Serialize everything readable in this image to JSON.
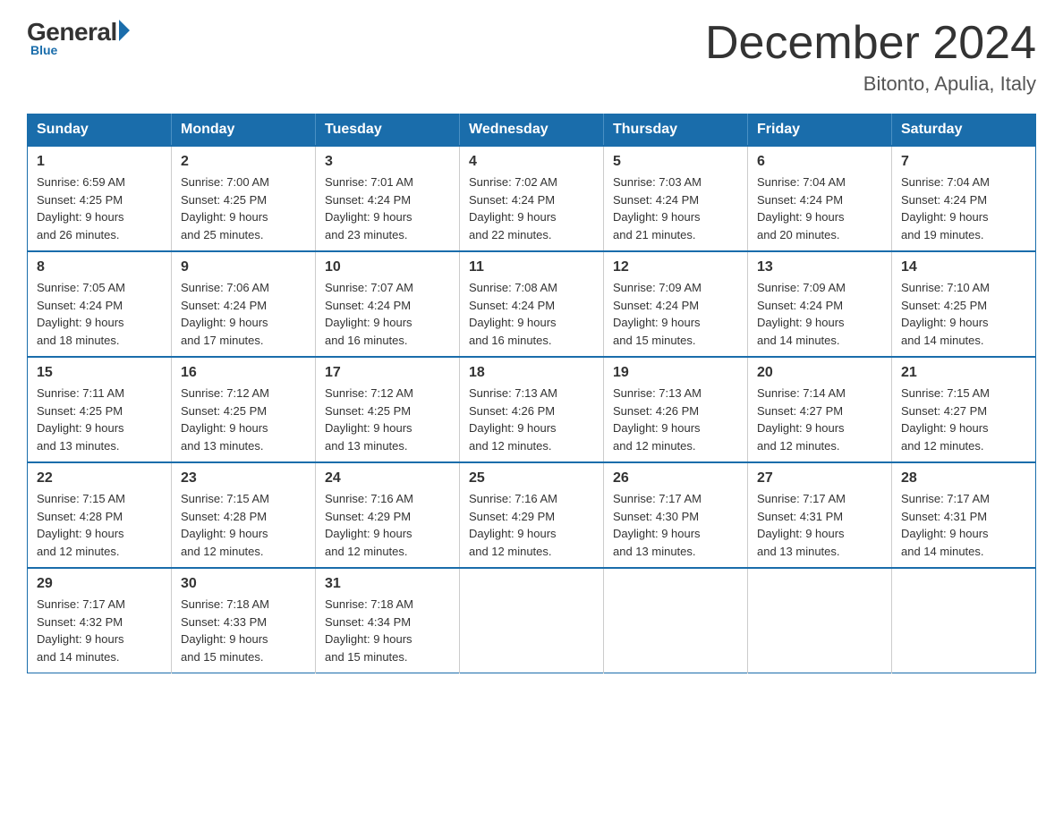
{
  "logo": {
    "general": "General",
    "blue": "Blue",
    "tagline": "Blue"
  },
  "header": {
    "month": "December 2024",
    "location": "Bitonto, Apulia, Italy"
  },
  "days_of_week": [
    "Sunday",
    "Monday",
    "Tuesday",
    "Wednesday",
    "Thursday",
    "Friday",
    "Saturday"
  ],
  "weeks": [
    [
      {
        "day": "1",
        "sunrise": "6:59 AM",
        "sunset": "4:25 PM",
        "daylight": "9 hours and 26 minutes."
      },
      {
        "day": "2",
        "sunrise": "7:00 AM",
        "sunset": "4:25 PM",
        "daylight": "9 hours and 25 minutes."
      },
      {
        "day": "3",
        "sunrise": "7:01 AM",
        "sunset": "4:24 PM",
        "daylight": "9 hours and 23 minutes."
      },
      {
        "day": "4",
        "sunrise": "7:02 AM",
        "sunset": "4:24 PM",
        "daylight": "9 hours and 22 minutes."
      },
      {
        "day": "5",
        "sunrise": "7:03 AM",
        "sunset": "4:24 PM",
        "daylight": "9 hours and 21 minutes."
      },
      {
        "day": "6",
        "sunrise": "7:04 AM",
        "sunset": "4:24 PM",
        "daylight": "9 hours and 20 minutes."
      },
      {
        "day": "7",
        "sunrise": "7:04 AM",
        "sunset": "4:24 PM",
        "daylight": "9 hours and 19 minutes."
      }
    ],
    [
      {
        "day": "8",
        "sunrise": "7:05 AM",
        "sunset": "4:24 PM",
        "daylight": "9 hours and 18 minutes."
      },
      {
        "day": "9",
        "sunrise": "7:06 AM",
        "sunset": "4:24 PM",
        "daylight": "9 hours and 17 minutes."
      },
      {
        "day": "10",
        "sunrise": "7:07 AM",
        "sunset": "4:24 PM",
        "daylight": "9 hours and 16 minutes."
      },
      {
        "day": "11",
        "sunrise": "7:08 AM",
        "sunset": "4:24 PM",
        "daylight": "9 hours and 16 minutes."
      },
      {
        "day": "12",
        "sunrise": "7:09 AM",
        "sunset": "4:24 PM",
        "daylight": "9 hours and 15 minutes."
      },
      {
        "day": "13",
        "sunrise": "7:09 AM",
        "sunset": "4:24 PM",
        "daylight": "9 hours and 14 minutes."
      },
      {
        "day": "14",
        "sunrise": "7:10 AM",
        "sunset": "4:25 PM",
        "daylight": "9 hours and 14 minutes."
      }
    ],
    [
      {
        "day": "15",
        "sunrise": "7:11 AM",
        "sunset": "4:25 PM",
        "daylight": "9 hours and 13 minutes."
      },
      {
        "day": "16",
        "sunrise": "7:12 AM",
        "sunset": "4:25 PM",
        "daylight": "9 hours and 13 minutes."
      },
      {
        "day": "17",
        "sunrise": "7:12 AM",
        "sunset": "4:25 PM",
        "daylight": "9 hours and 13 minutes."
      },
      {
        "day": "18",
        "sunrise": "7:13 AM",
        "sunset": "4:26 PM",
        "daylight": "9 hours and 12 minutes."
      },
      {
        "day": "19",
        "sunrise": "7:13 AM",
        "sunset": "4:26 PM",
        "daylight": "9 hours and 12 minutes."
      },
      {
        "day": "20",
        "sunrise": "7:14 AM",
        "sunset": "4:27 PM",
        "daylight": "9 hours and 12 minutes."
      },
      {
        "day": "21",
        "sunrise": "7:15 AM",
        "sunset": "4:27 PM",
        "daylight": "9 hours and 12 minutes."
      }
    ],
    [
      {
        "day": "22",
        "sunrise": "7:15 AM",
        "sunset": "4:28 PM",
        "daylight": "9 hours and 12 minutes."
      },
      {
        "day": "23",
        "sunrise": "7:15 AM",
        "sunset": "4:28 PM",
        "daylight": "9 hours and 12 minutes."
      },
      {
        "day": "24",
        "sunrise": "7:16 AM",
        "sunset": "4:29 PM",
        "daylight": "9 hours and 12 minutes."
      },
      {
        "day": "25",
        "sunrise": "7:16 AM",
        "sunset": "4:29 PM",
        "daylight": "9 hours and 12 minutes."
      },
      {
        "day": "26",
        "sunrise": "7:17 AM",
        "sunset": "4:30 PM",
        "daylight": "9 hours and 13 minutes."
      },
      {
        "day": "27",
        "sunrise": "7:17 AM",
        "sunset": "4:31 PM",
        "daylight": "9 hours and 13 minutes."
      },
      {
        "day": "28",
        "sunrise": "7:17 AM",
        "sunset": "4:31 PM",
        "daylight": "9 hours and 14 minutes."
      }
    ],
    [
      {
        "day": "29",
        "sunrise": "7:17 AM",
        "sunset": "4:32 PM",
        "daylight": "9 hours and 14 minutes."
      },
      {
        "day": "30",
        "sunrise": "7:18 AM",
        "sunset": "4:33 PM",
        "daylight": "9 hours and 15 minutes."
      },
      {
        "day": "31",
        "sunrise": "7:18 AM",
        "sunset": "4:34 PM",
        "daylight": "9 hours and 15 minutes."
      },
      null,
      null,
      null,
      null
    ]
  ],
  "labels": {
    "sunrise": "Sunrise:",
    "sunset": "Sunset:",
    "daylight": "Daylight:"
  }
}
